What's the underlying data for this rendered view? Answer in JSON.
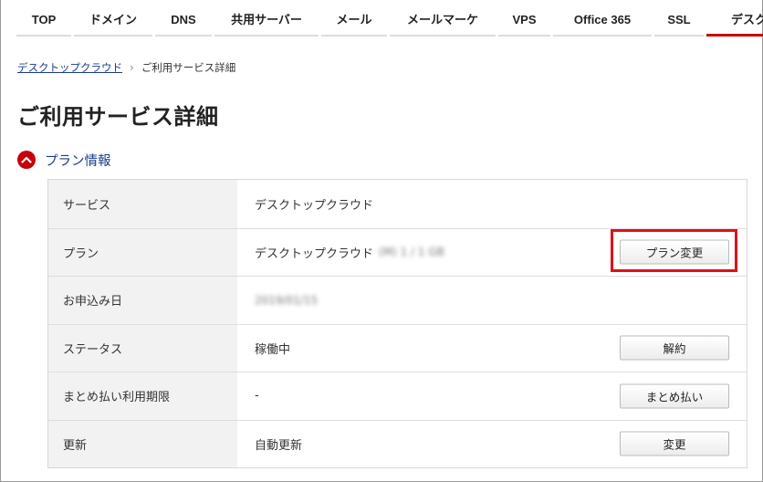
{
  "nav": {
    "items": [
      "TOP",
      "ドメイン",
      "DNS",
      "共用サーバー",
      "メール",
      "メールマーケ",
      "VPS",
      "Office 365",
      "SSL",
      "デスク"
    ],
    "active_index": 9,
    "accent_color": "#c8000b"
  },
  "breadcrumb": {
    "link": "デスクトップクラウド",
    "separator": "›",
    "current": "ご利用サービス詳細"
  },
  "page_title": "ご利用サービス詳細",
  "section": {
    "icon": "chevron-up-icon",
    "label": "プラン情報"
  },
  "details": {
    "rows": [
      {
        "label": "サービス",
        "value": "デスクトップクラウド"
      },
      {
        "label": "プラン",
        "value": "デスクトップクラウド",
        "blurred": "(M) 1 / 1 GB",
        "button": "プラン変更"
      },
      {
        "label": "お申込み日",
        "value": "",
        "blurred": "2019/01/15"
      },
      {
        "label": "ステータス",
        "value": "稼働中",
        "button": "解約"
      },
      {
        "label": "まとめ払い利用期限",
        "value": "-",
        "button": "まとめ払い"
      },
      {
        "label": "更新",
        "value": "自動更新",
        "button": "変更"
      }
    ]
  },
  "highlight_color": "#e0101a"
}
